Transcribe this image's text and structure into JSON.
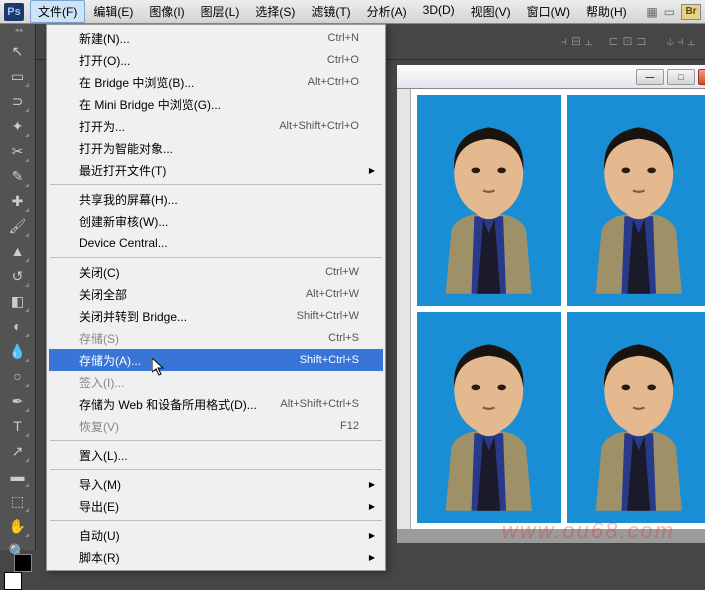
{
  "app": {
    "logo": "Ps"
  },
  "menubar": {
    "items": [
      "文件(F)",
      "编辑(E)",
      "图像(I)",
      "图层(L)",
      "选择(S)",
      "滤镜(T)",
      "分析(A)",
      "3D(D)",
      "视图(V)",
      "窗口(W)",
      "帮助(H)"
    ],
    "active_index": 0,
    "br_badge": "Br"
  },
  "dropdown": {
    "sections": [
      [
        {
          "label": "新建(N)...",
          "shortcut": "Ctrl+N"
        },
        {
          "label": "打开(O)...",
          "shortcut": "Ctrl+O"
        },
        {
          "label": "在 Bridge 中浏览(B)...",
          "shortcut": "Alt+Ctrl+O"
        },
        {
          "label": "在 Mini Bridge 中浏览(G)...",
          "shortcut": ""
        },
        {
          "label": "打开为...",
          "shortcut": "Alt+Shift+Ctrl+O"
        },
        {
          "label": "打开为智能对象...",
          "shortcut": ""
        },
        {
          "label": "最近打开文件(T)",
          "shortcut": "",
          "submenu": true
        }
      ],
      [
        {
          "label": "共享我的屏幕(H)...",
          "shortcut": ""
        },
        {
          "label": "创建新审核(W)...",
          "shortcut": ""
        },
        {
          "label": "Device Central...",
          "shortcut": ""
        }
      ],
      [
        {
          "label": "关闭(C)",
          "shortcut": "Ctrl+W"
        },
        {
          "label": "关闭全部",
          "shortcut": "Alt+Ctrl+W"
        },
        {
          "label": "关闭并转到 Bridge...",
          "shortcut": "Shift+Ctrl+W"
        },
        {
          "label": "存储(S)",
          "shortcut": "Ctrl+S",
          "disabled": true
        },
        {
          "label": "存储为(A)...",
          "shortcut": "Shift+Ctrl+S",
          "highlighted": true
        },
        {
          "label": "签入(I)...",
          "shortcut": "",
          "disabled": true
        },
        {
          "label": "存储为 Web 和设备所用格式(D)...",
          "shortcut": "Alt+Shift+Ctrl+S"
        },
        {
          "label": "恢复(V)",
          "shortcut": "F12",
          "disabled": true
        }
      ],
      [
        {
          "label": "置入(L)...",
          "shortcut": ""
        }
      ],
      [
        {
          "label": "导入(M)",
          "shortcut": "",
          "submenu": true
        },
        {
          "label": "导出(E)",
          "shortcut": "",
          "submenu": true
        }
      ],
      [
        {
          "label": "自动(U)",
          "shortcut": "",
          "submenu": true
        },
        {
          "label": "脚本(R)",
          "shortcut": "",
          "submenu": true
        }
      ]
    ]
  },
  "tools": [
    {
      "name": "move-tool",
      "glyph": "↖",
      "corner": false
    },
    {
      "name": "marquee-tool",
      "glyph": "▭",
      "corner": true
    },
    {
      "name": "lasso-tool",
      "glyph": "⊃",
      "corner": true
    },
    {
      "name": "magic-wand-tool",
      "glyph": "✦",
      "corner": true
    },
    {
      "name": "crop-tool",
      "glyph": "✂",
      "corner": true
    },
    {
      "name": "eyedropper-tool",
      "glyph": "✎",
      "corner": true
    },
    {
      "name": "healing-tool",
      "glyph": "✚",
      "corner": true
    },
    {
      "name": "brush-tool",
      "glyph": "🖌",
      "corner": true
    },
    {
      "name": "stamp-tool",
      "glyph": "▲",
      "corner": true
    },
    {
      "name": "history-brush-tool",
      "glyph": "↺",
      "corner": true
    },
    {
      "name": "eraser-tool",
      "glyph": "◧",
      "corner": true
    },
    {
      "name": "gradient-tool",
      "glyph": "◐",
      "corner": true
    },
    {
      "name": "blur-tool",
      "glyph": "💧",
      "corner": true
    },
    {
      "name": "dodge-tool",
      "glyph": "○",
      "corner": true
    },
    {
      "name": "pen-tool",
      "glyph": "✒",
      "corner": true
    },
    {
      "name": "type-tool",
      "glyph": "T",
      "corner": true
    },
    {
      "name": "path-tool",
      "glyph": "↗",
      "corner": true
    },
    {
      "name": "shape-tool",
      "glyph": "▬",
      "corner": true
    },
    {
      "name": "3d-tool",
      "glyph": "⬚",
      "corner": true
    },
    {
      "name": "hand-tool",
      "glyph": "✋",
      "corner": true
    },
    {
      "name": "zoom-tool",
      "glyph": "🔍",
      "corner": false
    }
  ],
  "colors": {
    "fg": "#ffffff",
    "bg": "#000000"
  },
  "document": {
    "layout": "2x2-photo-grid",
    "photo_bg": "#1a8ed4"
  },
  "watermark": "www.ou68.com"
}
